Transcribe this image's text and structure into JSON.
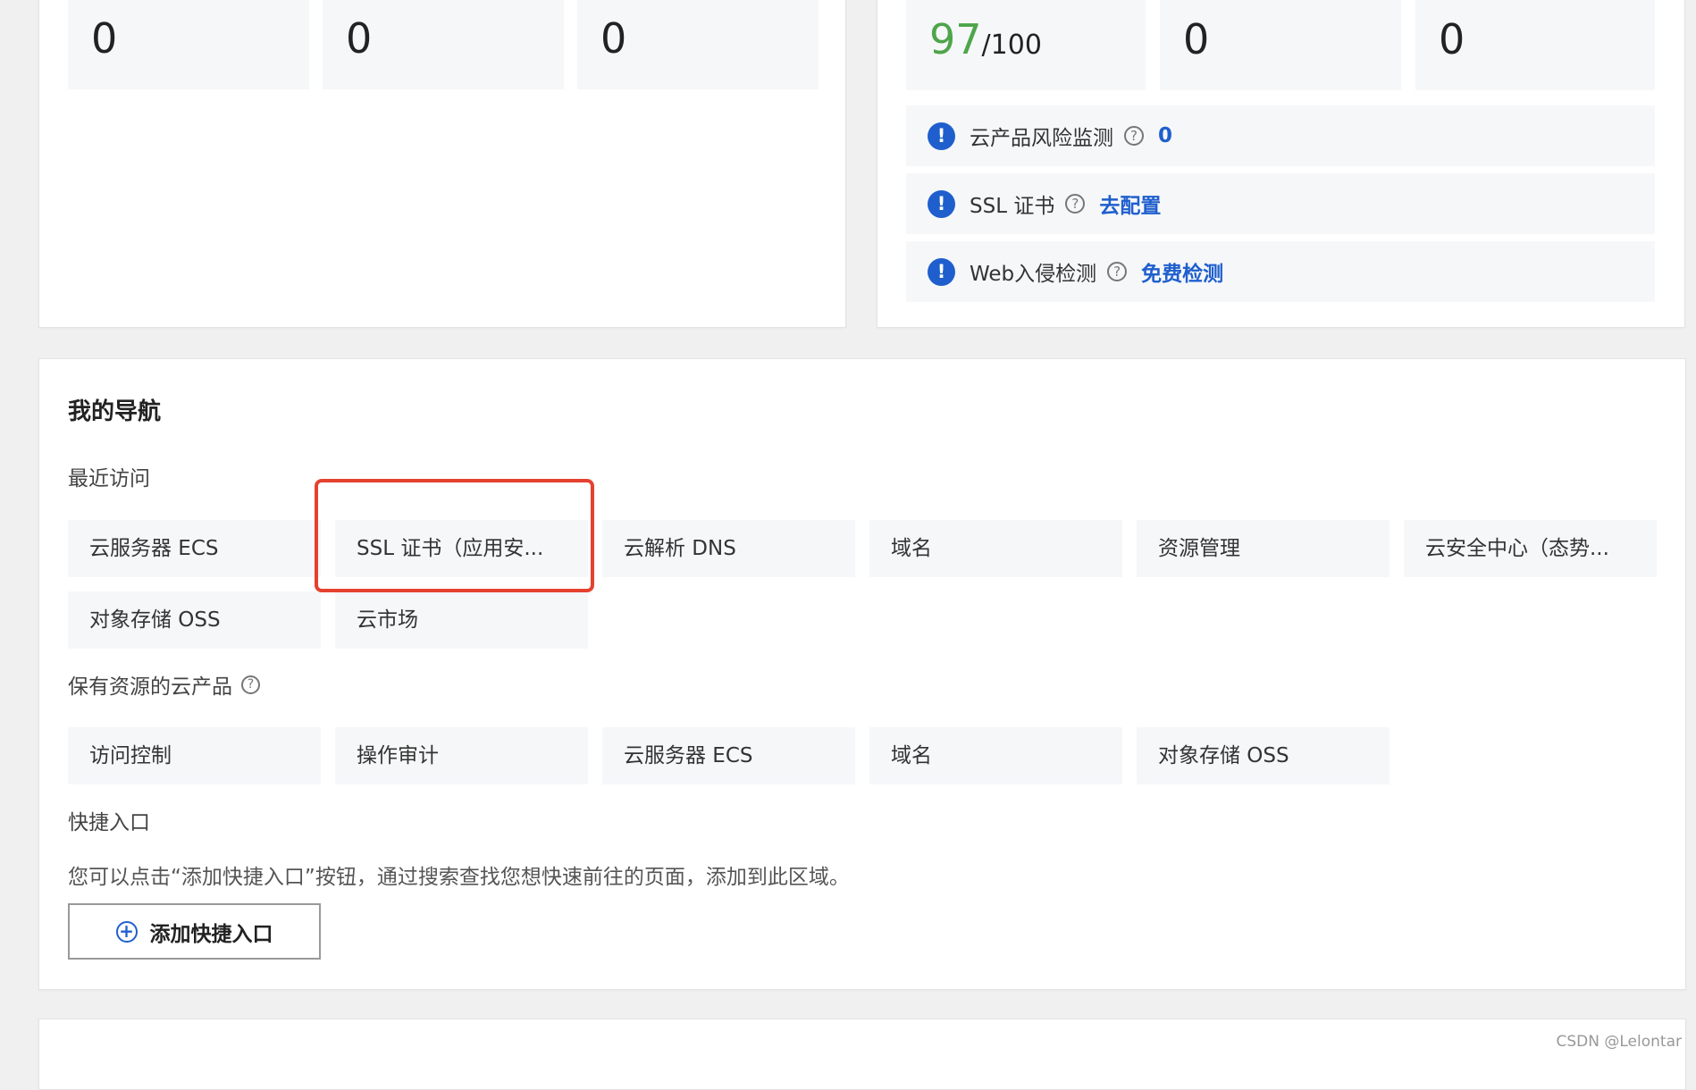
{
  "top_left_card": {
    "stats": [
      {
        "value": "0"
      },
      {
        "value": "0"
      },
      {
        "value": "0"
      }
    ]
  },
  "top_right_card": {
    "score": {
      "value": "97",
      "suffix": "/100",
      "color": "#4ea54a"
    },
    "stats": [
      {
        "value": "0"
      },
      {
        "value": "0"
      }
    ],
    "risks": [
      {
        "label": "云产品风险监测",
        "link": "0"
      },
      {
        "label": "SSL 证书",
        "link": "去配置"
      },
      {
        "label": "Web入侵检测",
        "link": "免费检测"
      }
    ]
  },
  "my_nav": {
    "title": "我的导航",
    "recent_label": "最近访问",
    "recent": [
      "云服务器 ECS",
      "SSL 证书（应用安...",
      "云解析 DNS",
      "域名",
      "资源管理",
      "云安全中心（态势...",
      "对象存储 OSS",
      "云市场"
    ],
    "owned_label": "保有资源的云产品",
    "owned": [
      "访问控制",
      "操作审计",
      "云服务器 ECS",
      "域名",
      "对象存储 OSS"
    ],
    "shortcut_label": "快捷入口",
    "shortcut_desc": "您可以点击“添加快捷入口”按钮，通过搜索查找您想快速前往的页面，添加到此区域。",
    "add_button": "添加快捷入口"
  },
  "watermark": "CSDN @Lelontar",
  "colors": {
    "accent": "#1f5fcd",
    "highlight": "#e5412f",
    "score_green": "#4ea54a"
  },
  "icons": {
    "alert": "exclamation-circle-icon",
    "help": "question-circle-icon",
    "plus": "plus-circle-icon"
  }
}
